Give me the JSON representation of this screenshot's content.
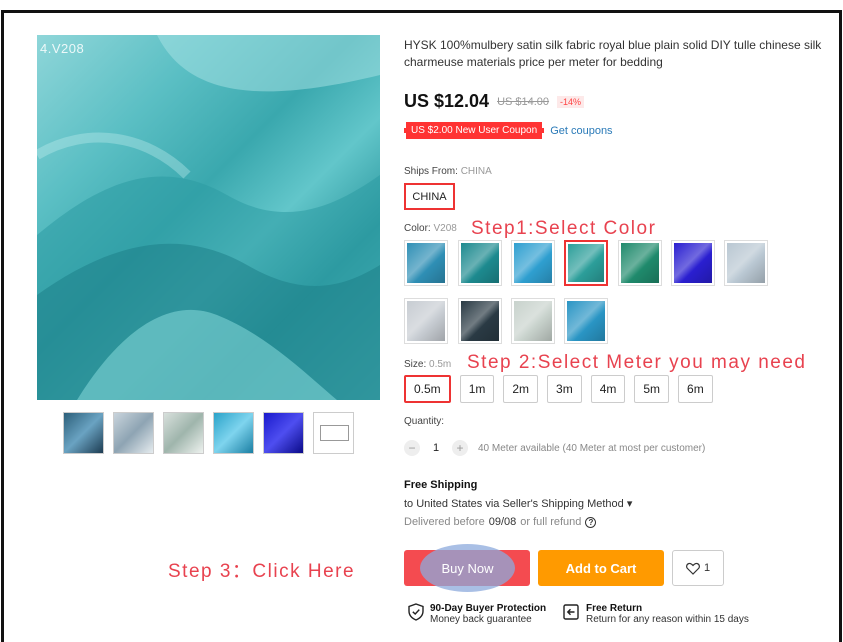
{
  "image": {
    "label": "4.V208"
  },
  "thumbnails": [
    "thumb-1",
    "thumb-2",
    "thumb-3",
    "thumb-4",
    "thumb-5",
    "thumb-6"
  ],
  "product": {
    "title": "HYSK 100%mulbery satin silk fabric royal blue plain solid DIY tulle chinese silk charmeuse materials price per meter for bedding",
    "price": "US $12.04",
    "old_price": "US $14.00",
    "discount": "-14%",
    "coupon": "US $2.00 New User Coupon",
    "get_coupons": "Get coupons"
  },
  "ships_from": {
    "label": "Ships From:",
    "value": "CHINA",
    "option": "CHINA"
  },
  "color": {
    "label": "Color:",
    "value": "V208",
    "swatch_colors": [
      "#2f8fb5",
      "#1d8a8f",
      "#2f9fd0",
      "#2c9e9a",
      "#1f8a6c",
      "#2a1fd0",
      "#b9c7d2",
      "#c7ccd2",
      "#2a3a44",
      "#c8d2cc",
      "#2a95c4"
    ],
    "selected_index": 3
  },
  "size": {
    "label": "Size:",
    "value": "0.5m",
    "options": [
      "0.5m",
      "1m",
      "2m",
      "3m",
      "4m",
      "5m",
      "6m"
    ]
  },
  "quantity": {
    "label": "Quantity:",
    "value": "1",
    "minus": "−",
    "plus": "+",
    "note": "40 Meter available (40 Meter at most per customer)"
  },
  "shipping": {
    "title": "Free Shipping",
    "to": "to United States via Seller's Shipping Method ▾",
    "delivered_prefix": "Delivered before",
    "delivered_date": "09/08",
    "delivered_suffix": "or full refund"
  },
  "actions": {
    "buy_now": "Buy Now",
    "add_to_cart": "Add to Cart",
    "wish_count": "1"
  },
  "guarantees": {
    "protection_title": "90-Day Buyer Protection",
    "protection_sub": "Money back guarantee",
    "return_title": "Free Return",
    "return_sub": "Return for any reason within 15 days"
  },
  "annotations": {
    "step1": "Step1:Select Color",
    "step2": "Step 2:Select Meter you may need",
    "step3": "Step 3：Click Here"
  }
}
